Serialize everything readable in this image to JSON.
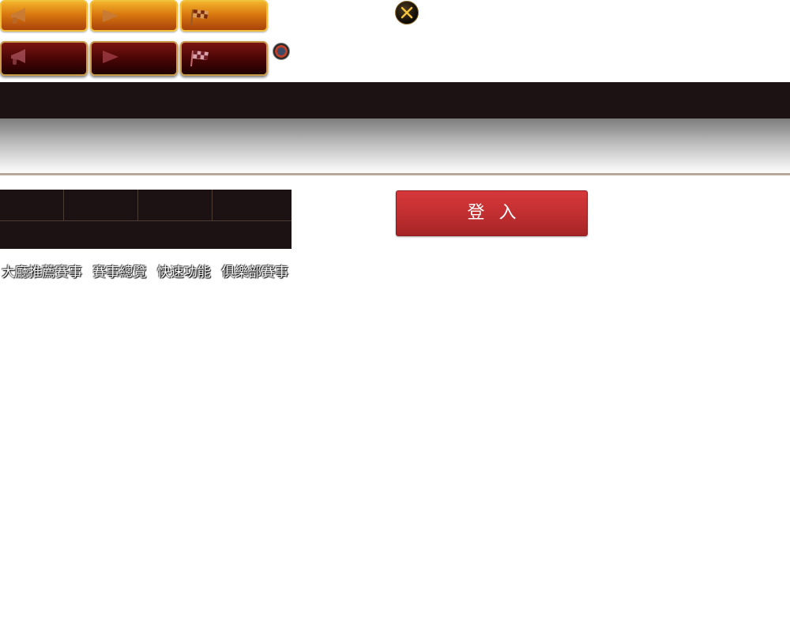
{
  "top_buttons": [
    {
      "icon": "megaphone-icon"
    },
    {
      "icon": "flag-icon"
    },
    {
      "icon": "checkered-flag-icon"
    }
  ],
  "close": {
    "icon": "close-icon"
  },
  "chip": {
    "icon": "casino-chip-icon"
  },
  "login": {
    "label": "登入"
  },
  "nav": {
    "items": [
      {
        "label": "大廳推薦賽事"
      },
      {
        "label": "賽事總覽"
      },
      {
        "label": "快速功能"
      },
      {
        "label": "俱樂部賽事"
      }
    ]
  },
  "colors": {
    "header": "#1c1214",
    "login": "#c22f31",
    "gold": "#e08a14"
  }
}
